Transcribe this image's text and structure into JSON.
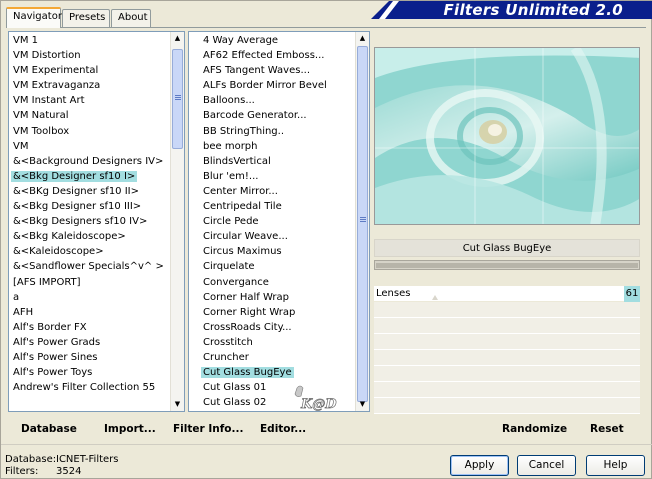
{
  "window": {
    "title": "Filters Unlimited 2.0"
  },
  "tabs": [
    {
      "label": "Navigator"
    },
    {
      "label": "Presets"
    },
    {
      "label": "About"
    }
  ],
  "categories": {
    "items": [
      "VM 1",
      "VM Distortion",
      "VM Experimental",
      "VM Extravaganza",
      "VM Instant Art",
      "VM Natural",
      "VM Toolbox",
      "VM",
      "&<Background Designers IV>",
      "&<Bkg Designer sf10 I>",
      "&<BKg Designer sf10 II>",
      "&<Bkg Designer sf10 III>",
      "&<Bkg Designers sf10 IV>",
      "&<Bkg Kaleidoscope>",
      "&<Kaleidoscope>",
      "&<Sandflower Specials^v^ >",
      "[AFS IMPORT]",
      "a",
      "AFH",
      "Alf's Border FX",
      "Alf's Power Grads",
      "Alf's Power Sines",
      "Alf's Power Toys",
      "Andrew's Filter Collection 55"
    ],
    "selected_index": 9
  },
  "filters": {
    "items": [
      "4 Way Average",
      "AF62 Effected Emboss...",
      "AFS Tangent Waves...",
      "ALFs Border Mirror Bevel",
      "Balloons...",
      "Barcode Generator...",
      "BB StringThing..",
      "bee morph",
      "BlindsVertical",
      "Blur 'em!...",
      "Center Mirror...",
      "Centripedal Tile",
      "Circle Pede",
      "Circular Weave...",
      "Circus Maximus",
      "Cirquelate",
      "Convergance",
      "Corner Half Wrap",
      "Corner Right Wrap",
      "CrossRoads City...",
      "Crosstitch",
      "Cruncher",
      "Cut Glass  BugEye",
      "Cut Glass 01",
      "Cut Glass 02"
    ],
    "selected_index": 22
  },
  "preview": {
    "filter_name": "Cut Glass  BugEye",
    "progress": 1.0
  },
  "parameters": [
    {
      "label": "Lenses",
      "value": "61"
    }
  ],
  "bottom_links": {
    "database": "Database",
    "import": "Import...",
    "filter_info": "Filter Info...",
    "editor": "Editor...",
    "randomize": "Randomize",
    "reset": "Reset"
  },
  "info": {
    "database_label": "Database:",
    "database_value": "ICNET-Filters",
    "filters_label": "Filters:",
    "filters_value": "3524"
  },
  "buttons": {
    "apply": "Apply",
    "cancel": "Cancel",
    "help": "Help"
  },
  "colors": {
    "selection": "#a2dde0",
    "banner": "#0a1f8c",
    "background": "#ece9d8"
  },
  "logo_text": "K@D"
}
